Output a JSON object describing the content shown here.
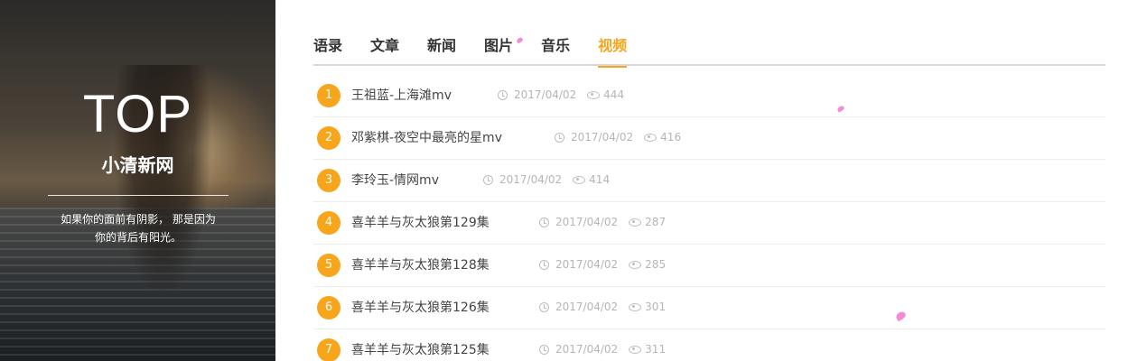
{
  "hero": {
    "title": "TOP",
    "subtitle": "小清新网",
    "quote_line1": "如果你的面前有阴影， 那是因为",
    "quote_line2": "你的背后有阳光。"
  },
  "tabs": [
    {
      "label": "语录",
      "active": false
    },
    {
      "label": "文章",
      "active": false
    },
    {
      "label": "新闻",
      "active": false
    },
    {
      "label": "图片",
      "active": false
    },
    {
      "label": "音乐",
      "active": false
    },
    {
      "label": "视频",
      "active": true
    }
  ],
  "items": [
    {
      "rank": "1",
      "title": "王祖蓝-上海滩mv",
      "date": "2017/04/02",
      "views": "444"
    },
    {
      "rank": "2",
      "title": "邓紫棋-夜空中最亮的星mv",
      "date": "2017/04/02",
      "views": "416"
    },
    {
      "rank": "3",
      "title": "李玲玉-情网mv",
      "date": "2017/04/02",
      "views": "414"
    },
    {
      "rank": "4",
      "title": "喜羊羊与灰太狼第129集",
      "date": "2017/04/02",
      "views": "287"
    },
    {
      "rank": "5",
      "title": "喜羊羊与灰太狼第128集",
      "date": "2017/04/02",
      "views": "285"
    },
    {
      "rank": "6",
      "title": "喜羊羊与灰太狼第126集",
      "date": "2017/04/02",
      "views": "301"
    },
    {
      "rank": "7",
      "title": "喜羊羊与灰太狼第125集",
      "date": "2017/04/02",
      "views": "311"
    }
  ],
  "colors": {
    "accent": "#f7a51b",
    "petal": "#f38bd6"
  },
  "icons": {
    "date": "clock-icon",
    "views": "eye-icon"
  }
}
